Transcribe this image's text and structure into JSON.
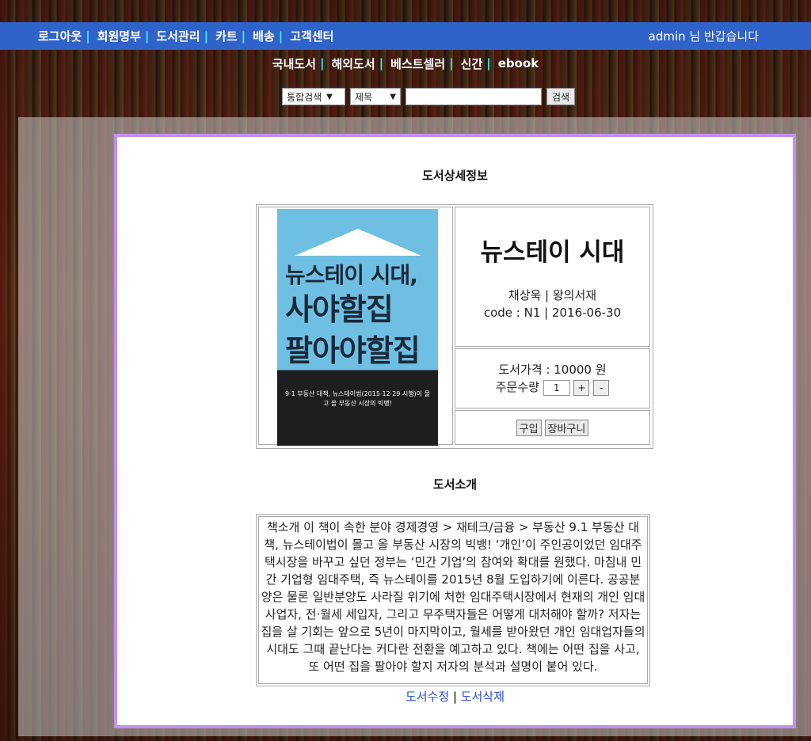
{
  "topbar": {
    "menu": [
      "로그아웃",
      "회원명부",
      "도서관리",
      "카트",
      "배송",
      "고객센터"
    ],
    "greeting": "admin 님 반갑습니다"
  },
  "subnav": [
    "국내도서",
    "해외도서",
    "베스트셀러",
    "신간",
    "ebook"
  ],
  "search": {
    "scope": "통합검색",
    "field": "제목",
    "query": "",
    "button": "검색"
  },
  "detail": {
    "heading": "도서상세정보",
    "cover_title_lines": [
      "뉴스테이 시대,",
      "사야할집",
      "팔아야할집"
    ],
    "cover_tagline": "9·1 부동산 대책, 뉴스테이법(2015·12·29 시행)이 몰고 올 부동산 시장의 빅뱅!",
    "title": "뉴스테이 시대",
    "author_publisher": "채상욱 | 왕의서재",
    "code_date": "code : N1 | 2016-06-30",
    "price_line": "도서가격 : 10000 원",
    "qty_label": "주문수량",
    "qty_value": "1",
    "plus": "+",
    "minus": "-",
    "buy_button": "구입",
    "cart_button": "장바구니"
  },
  "intro": {
    "heading": "도서소개",
    "text": "책소개 이 책이 속한 분야 경제경영 > 재테크/금융 > 부동산 9.1 부동산 대책, 뉴스테이법이 몰고 올 부동산 시장의 빅뱅! ‘개인’이 주인공이었던 임대주택시장을 바꾸고 싶던 정부는 ‘민간 기업’의 참여와 확대를 원했다. 마침내 민간 기업형 임대주택, 즉 뉴스테이를 2015년 8월 도입하기에 이른다. 공공분양은 물론 일반분양도 사라질 위기에 처한 임대주택시장에서 현재의 개인 임대사업자, 전·월세 세입자, 그리고 무주택자들은 어떻게 대처해야 할까? 저자는 집을 살 기회는 앞으로 5년이 마지막이고, 월세를 받아왔던 개인 임대업자들의 시대도 그때 끝난다는 커다란 전환을 예고하고 있다. 책에는 어떤 집을 사고, 또 어떤 집을 팔아야 할지 저자의 분석과 설명이 붙어 있다."
  },
  "actions": {
    "edit": "도서수정",
    "separator": "|",
    "delete": "도서삭제"
  }
}
